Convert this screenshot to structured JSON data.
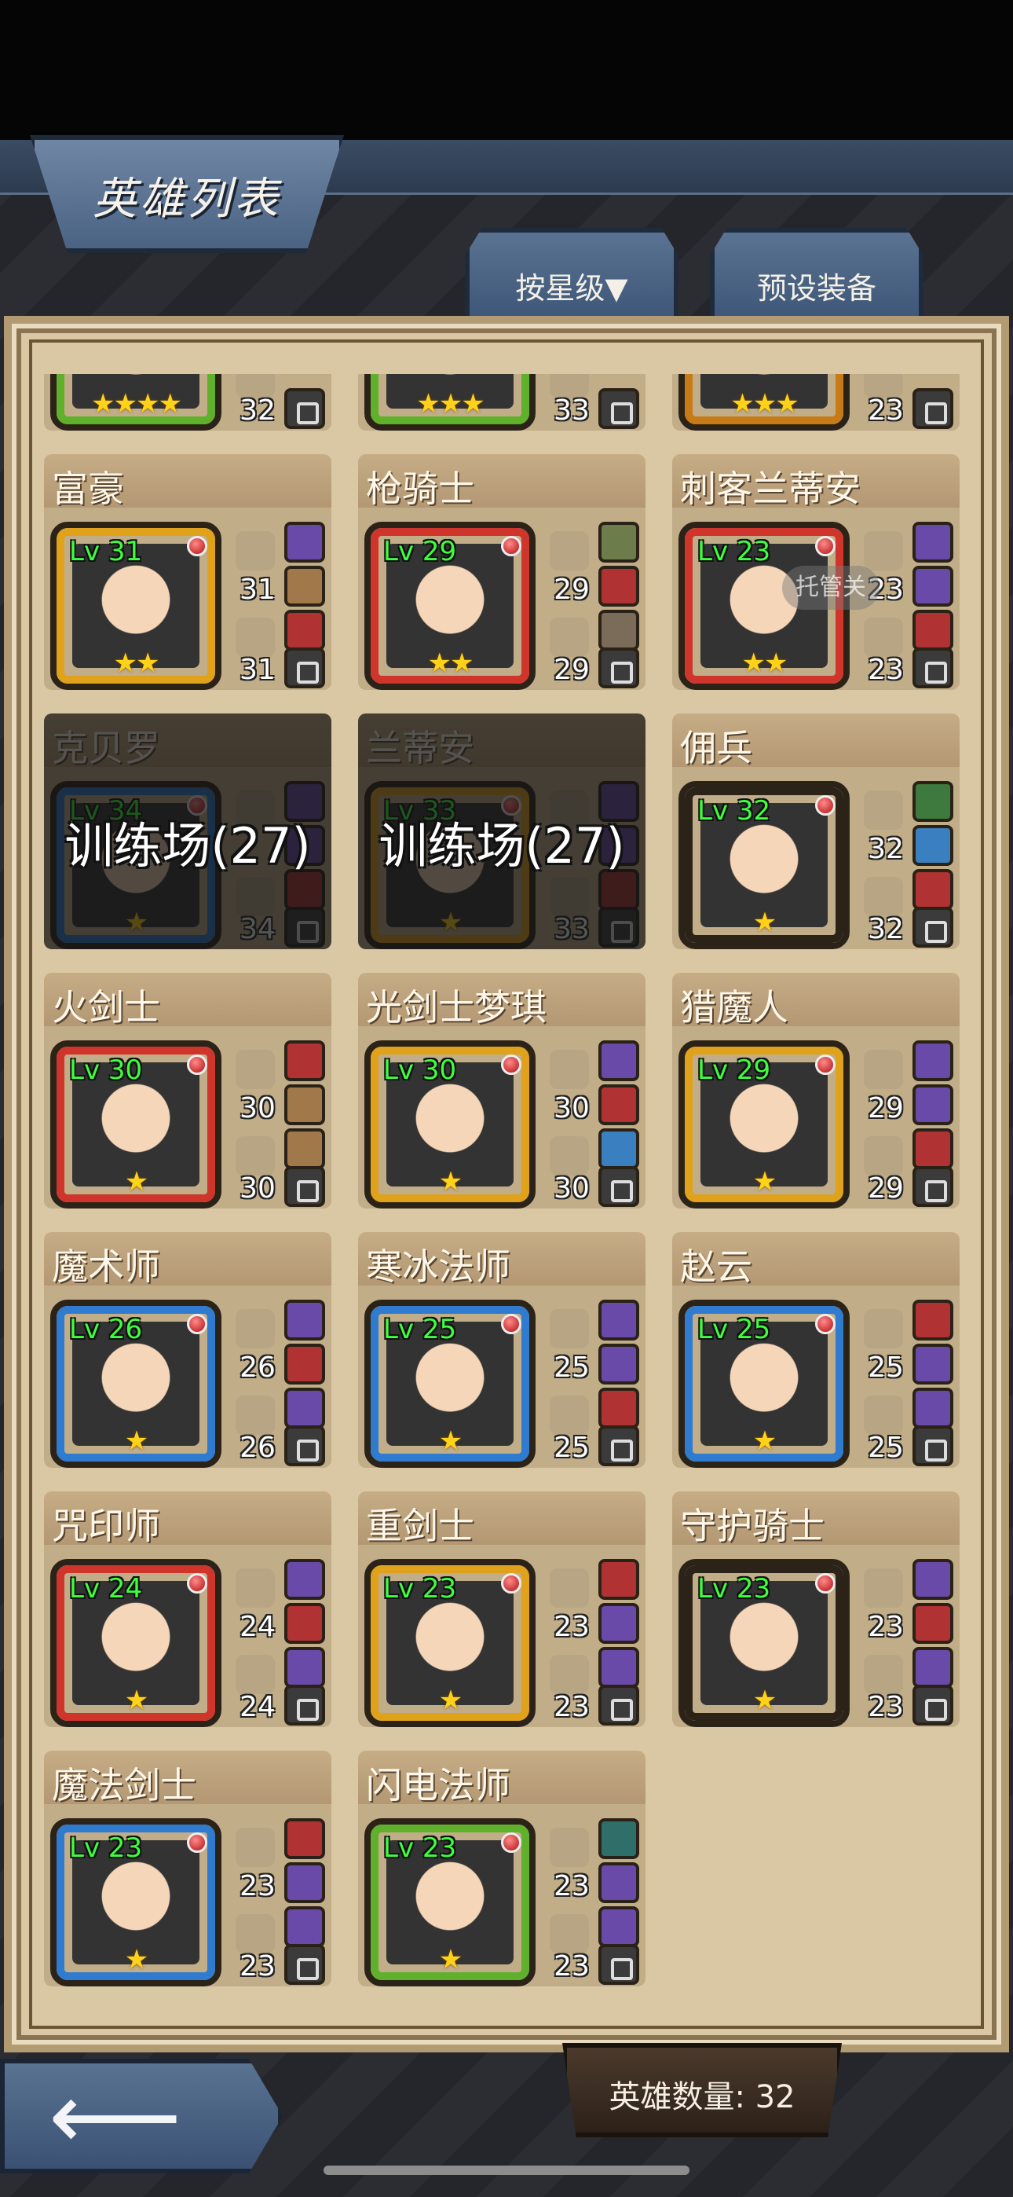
{
  "header": {
    "title": "英雄列表"
  },
  "tabs": {
    "sort_label": "按星级▼",
    "preset_label": "预设装备"
  },
  "toast": "托管关",
  "partial_row": [
    {
      "attack": "32",
      "stars": "★★★★",
      "frame": "#5fb12b"
    },
    {
      "attack": "33",
      "stars": "★★★",
      "frame": "#5fb12b"
    },
    {
      "attack": "23",
      "stars": "★★★",
      "frame": "#c77b16"
    }
  ],
  "heroes": [
    {
      "name": "富豪",
      "level": "Lv 31",
      "attack": "31",
      "defense": "31",
      "stars": "★★",
      "frame": "#e0a21a",
      "slots": [
        "#6a4aa8",
        "#a0784a",
        "#b13232"
      ],
      "training": ""
    },
    {
      "name": "枪骑士",
      "level": "Lv 29",
      "attack": "29",
      "defense": "29",
      "stars": "★★",
      "frame": "#d0352c",
      "slots": [
        "#6c7c4a",
        "#b13232",
        "#7a6c58"
      ],
      "training": ""
    },
    {
      "name": "刺客兰蒂安",
      "level": "Lv 23",
      "attack": "23",
      "defense": "23",
      "stars": "★★",
      "frame": "#d0352c",
      "slots": [
        "#6a4aa8",
        "#6a4aa8",
        "#b13232"
      ],
      "training": ""
    },
    {
      "name": "克贝罗",
      "level": "Lv 34",
      "attack": "",
      "defense": "34",
      "stars": "★",
      "frame": "#2e7bd0",
      "slots": [
        "#6a4aa8",
        "#6a4aa8",
        "#b13232"
      ],
      "training": "训练场(27)"
    },
    {
      "name": "兰蒂安",
      "level": "Lv 33",
      "attack": "",
      "defense": "33",
      "stars": "★",
      "frame": "#e0a21a",
      "slots": [
        "#6a4aa8",
        "#6a4aa8",
        "#b13232"
      ],
      "training": "训练场(27)"
    },
    {
      "name": "佣兵",
      "level": "Lv 32",
      "attack": "32",
      "defense": "32",
      "stars": "★",
      "frame": "#2b2218",
      "slots": [
        "#3e7a3e",
        "#3a7fc0",
        "#b13232"
      ],
      "training": ""
    },
    {
      "name": "火剑士",
      "level": "Lv 30",
      "attack": "30",
      "defense": "30",
      "stars": "★",
      "frame": "#d0352c",
      "slots": [
        "#b13232",
        "#a0784a",
        "#a0784a"
      ],
      "training": ""
    },
    {
      "name": "光剑士梦琪",
      "level": "Lv 30",
      "attack": "30",
      "defense": "30",
      "stars": "★",
      "frame": "#e0a21a",
      "slots": [
        "#6a4aa8",
        "#b13232",
        "#3a7fc0"
      ],
      "training": ""
    },
    {
      "name": "猎魔人",
      "level": "Lv 29",
      "attack": "29",
      "defense": "29",
      "stars": "★",
      "frame": "#e0a21a",
      "slots": [
        "#6a4aa8",
        "#6a4aa8",
        "#b13232"
      ],
      "training": ""
    },
    {
      "name": "魔术师",
      "level": "Lv 26",
      "attack": "26",
      "defense": "26",
      "stars": "★",
      "frame": "#2e7bd0",
      "slots": [
        "#6a4aa8",
        "#b13232",
        "#6a4aa8"
      ],
      "training": ""
    },
    {
      "name": "寒冰法师",
      "level": "Lv 25",
      "attack": "25",
      "defense": "25",
      "stars": "★",
      "frame": "#2e7bd0",
      "slots": [
        "#6a4aa8",
        "#6a4aa8",
        "#b13232"
      ],
      "training": ""
    },
    {
      "name": "赵云",
      "level": "Lv 25",
      "attack": "25",
      "defense": "25",
      "stars": "★",
      "frame": "#2e7bd0",
      "slots": [
        "#b13232",
        "#6a4aa8",
        "#6a4aa8"
      ],
      "training": ""
    },
    {
      "name": "咒印师",
      "level": "Lv 24",
      "attack": "24",
      "defense": "24",
      "stars": "★",
      "frame": "#d0352c",
      "slots": [
        "#6a4aa8",
        "#b13232",
        "#6a4aa8"
      ],
      "training": ""
    },
    {
      "name": "重剑士",
      "level": "Lv 23",
      "attack": "23",
      "defense": "23",
      "stars": "★",
      "frame": "#e0a21a",
      "slots": [
        "#b13232",
        "#6a4aa8",
        "#6a4aa8"
      ],
      "training": ""
    },
    {
      "name": "守护骑士",
      "level": "Lv 23",
      "attack": "23",
      "defense": "23",
      "stars": "★",
      "frame": "#2b2218",
      "slots": [
        "#6a4aa8",
        "#b13232",
        "#6a4aa8"
      ],
      "training": ""
    },
    {
      "name": "魔法剑士",
      "level": "Lv 23",
      "attack": "23",
      "defense": "23",
      "stars": "★",
      "frame": "#2e7bd0",
      "slots": [
        "#b13232",
        "#6a4aa8",
        "#6a4aa8"
      ],
      "training": ""
    },
    {
      "name": "闪电法师",
      "level": "Lv 23",
      "attack": "23",
      "defense": "23",
      "stars": "★",
      "frame": "#5fb12b",
      "slots": [
        "#2f6f6a",
        "#6a4aa8",
        "#6a4aa8"
      ],
      "training": ""
    }
  ],
  "footer": {
    "hero_count": "英雄数量: 32"
  }
}
